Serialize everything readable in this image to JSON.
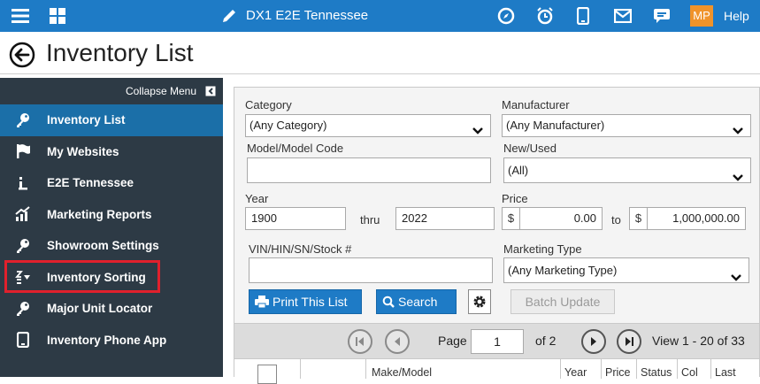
{
  "topbar": {
    "title": "DX1 E2E Tennessee",
    "user_initials": "MP",
    "help_label": "Help",
    "accent_color": "#1e7bc6",
    "badge_color": "#f0932a",
    "icons": [
      "hamburger-menu-icon",
      "apps-grid-icon",
      "pencil-icon",
      "compass-icon",
      "alarm-clock-icon",
      "mobile-phone-icon",
      "mail-icon",
      "chat-icon"
    ]
  },
  "header": {
    "title": "Inventory List"
  },
  "sidebar": {
    "collapse_label": "Collapse Menu",
    "items": [
      {
        "label": "Inventory List",
        "icon": "key-icon",
        "active": true
      },
      {
        "label": "My Websites",
        "icon": "flag-icon"
      },
      {
        "label": "E2E Tennessee",
        "icon": "info-icon"
      },
      {
        "label": "Marketing Reports",
        "icon": "chart-icon"
      },
      {
        "label": "Showroom Settings",
        "icon": "key-icon"
      },
      {
        "label": "Inventory Sorting",
        "icon": "sort-icon"
      },
      {
        "label": "Major Unit Locator",
        "icon": "key-icon"
      },
      {
        "label": "Inventory Phone App",
        "icon": "mobile-phone-icon"
      }
    ]
  },
  "filters": {
    "category": {
      "label": "Category",
      "value": "(Any Category)"
    },
    "manufacturer": {
      "label": "Manufacturer",
      "value": "(Any Manufacturer)"
    },
    "model": {
      "label": "Model/Model Code",
      "value": ""
    },
    "new_used": {
      "label": "New/Used",
      "value": "(All)"
    },
    "year": {
      "label": "Year",
      "from": "1900",
      "thru_label": "thru",
      "to": "2022"
    },
    "price": {
      "label": "Price",
      "currency": "$",
      "from": "0.00",
      "to_label": "to",
      "to": "1,000,000.00"
    },
    "vin": {
      "label": "VIN/HIN/SN/Stock #",
      "value": ""
    },
    "marketing_type": {
      "label": "Marketing Type",
      "value": "(Any Marketing Type)"
    }
  },
  "actions": {
    "print_label": "Print This List",
    "search_label": "Search",
    "batch_label": "Batch Update"
  },
  "pager": {
    "page_label": "Page",
    "page_value": "1",
    "of_label": "of 2",
    "view_label": "View 1 - 20 of 33"
  },
  "table": {
    "columns": [
      "Make/Model",
      "Year",
      "Price",
      "Status",
      "Col",
      "Last"
    ]
  }
}
